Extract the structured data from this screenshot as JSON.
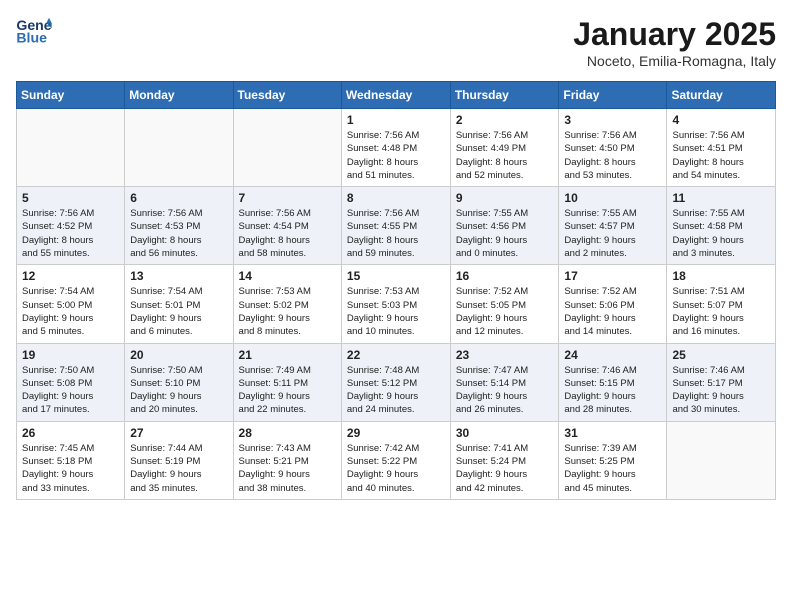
{
  "header": {
    "logo_line1": "General",
    "logo_line2": "Blue",
    "month": "January 2025",
    "location": "Noceto, Emilia-Romagna, Italy"
  },
  "weekdays": [
    "Sunday",
    "Monday",
    "Tuesday",
    "Wednesday",
    "Thursday",
    "Friday",
    "Saturday"
  ],
  "weeks": [
    [
      {
        "day": "",
        "info": ""
      },
      {
        "day": "",
        "info": ""
      },
      {
        "day": "",
        "info": ""
      },
      {
        "day": "1",
        "info": "Sunrise: 7:56 AM\nSunset: 4:48 PM\nDaylight: 8 hours\nand 51 minutes."
      },
      {
        "day": "2",
        "info": "Sunrise: 7:56 AM\nSunset: 4:49 PM\nDaylight: 8 hours\nand 52 minutes."
      },
      {
        "day": "3",
        "info": "Sunrise: 7:56 AM\nSunset: 4:50 PM\nDaylight: 8 hours\nand 53 minutes."
      },
      {
        "day": "4",
        "info": "Sunrise: 7:56 AM\nSunset: 4:51 PM\nDaylight: 8 hours\nand 54 minutes."
      }
    ],
    [
      {
        "day": "5",
        "info": "Sunrise: 7:56 AM\nSunset: 4:52 PM\nDaylight: 8 hours\nand 55 minutes."
      },
      {
        "day": "6",
        "info": "Sunrise: 7:56 AM\nSunset: 4:53 PM\nDaylight: 8 hours\nand 56 minutes."
      },
      {
        "day": "7",
        "info": "Sunrise: 7:56 AM\nSunset: 4:54 PM\nDaylight: 8 hours\nand 58 minutes."
      },
      {
        "day": "8",
        "info": "Sunrise: 7:56 AM\nSunset: 4:55 PM\nDaylight: 8 hours\nand 59 minutes."
      },
      {
        "day": "9",
        "info": "Sunrise: 7:55 AM\nSunset: 4:56 PM\nDaylight: 9 hours\nand 0 minutes."
      },
      {
        "day": "10",
        "info": "Sunrise: 7:55 AM\nSunset: 4:57 PM\nDaylight: 9 hours\nand 2 minutes."
      },
      {
        "day": "11",
        "info": "Sunrise: 7:55 AM\nSunset: 4:58 PM\nDaylight: 9 hours\nand 3 minutes."
      }
    ],
    [
      {
        "day": "12",
        "info": "Sunrise: 7:54 AM\nSunset: 5:00 PM\nDaylight: 9 hours\nand 5 minutes."
      },
      {
        "day": "13",
        "info": "Sunrise: 7:54 AM\nSunset: 5:01 PM\nDaylight: 9 hours\nand 6 minutes."
      },
      {
        "day": "14",
        "info": "Sunrise: 7:53 AM\nSunset: 5:02 PM\nDaylight: 9 hours\nand 8 minutes."
      },
      {
        "day": "15",
        "info": "Sunrise: 7:53 AM\nSunset: 5:03 PM\nDaylight: 9 hours\nand 10 minutes."
      },
      {
        "day": "16",
        "info": "Sunrise: 7:52 AM\nSunset: 5:05 PM\nDaylight: 9 hours\nand 12 minutes."
      },
      {
        "day": "17",
        "info": "Sunrise: 7:52 AM\nSunset: 5:06 PM\nDaylight: 9 hours\nand 14 minutes."
      },
      {
        "day": "18",
        "info": "Sunrise: 7:51 AM\nSunset: 5:07 PM\nDaylight: 9 hours\nand 16 minutes."
      }
    ],
    [
      {
        "day": "19",
        "info": "Sunrise: 7:50 AM\nSunset: 5:08 PM\nDaylight: 9 hours\nand 17 minutes."
      },
      {
        "day": "20",
        "info": "Sunrise: 7:50 AM\nSunset: 5:10 PM\nDaylight: 9 hours\nand 20 minutes."
      },
      {
        "day": "21",
        "info": "Sunrise: 7:49 AM\nSunset: 5:11 PM\nDaylight: 9 hours\nand 22 minutes."
      },
      {
        "day": "22",
        "info": "Sunrise: 7:48 AM\nSunset: 5:12 PM\nDaylight: 9 hours\nand 24 minutes."
      },
      {
        "day": "23",
        "info": "Sunrise: 7:47 AM\nSunset: 5:14 PM\nDaylight: 9 hours\nand 26 minutes."
      },
      {
        "day": "24",
        "info": "Sunrise: 7:46 AM\nSunset: 5:15 PM\nDaylight: 9 hours\nand 28 minutes."
      },
      {
        "day": "25",
        "info": "Sunrise: 7:46 AM\nSunset: 5:17 PM\nDaylight: 9 hours\nand 30 minutes."
      }
    ],
    [
      {
        "day": "26",
        "info": "Sunrise: 7:45 AM\nSunset: 5:18 PM\nDaylight: 9 hours\nand 33 minutes."
      },
      {
        "day": "27",
        "info": "Sunrise: 7:44 AM\nSunset: 5:19 PM\nDaylight: 9 hours\nand 35 minutes."
      },
      {
        "day": "28",
        "info": "Sunrise: 7:43 AM\nSunset: 5:21 PM\nDaylight: 9 hours\nand 38 minutes."
      },
      {
        "day": "29",
        "info": "Sunrise: 7:42 AM\nSunset: 5:22 PM\nDaylight: 9 hours\nand 40 minutes."
      },
      {
        "day": "30",
        "info": "Sunrise: 7:41 AM\nSunset: 5:24 PM\nDaylight: 9 hours\nand 42 minutes."
      },
      {
        "day": "31",
        "info": "Sunrise: 7:39 AM\nSunset: 5:25 PM\nDaylight: 9 hours\nand 45 minutes."
      },
      {
        "day": "",
        "info": ""
      }
    ]
  ]
}
